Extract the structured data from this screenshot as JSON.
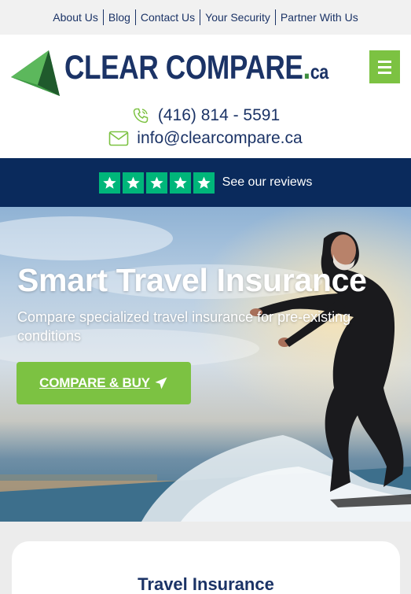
{
  "top_nav": {
    "items": [
      {
        "label": "About Us"
      },
      {
        "label": "Blog"
      },
      {
        "label": "Contact Us"
      },
      {
        "label": "Your Security"
      },
      {
        "label": "Partner With Us"
      }
    ]
  },
  "header": {
    "logo_text": "CLEAR COMPARE",
    "logo_dot": ".",
    "logo_suffix": "ca",
    "menu_icon": "hamburger-icon",
    "phone": "(416) 814 - 5591",
    "phone_icon": "phone-icon",
    "email": "info@clearcompare.ca",
    "email_icon": "envelope-icon"
  },
  "trust": {
    "rating_stars": 5,
    "reviews_link": "See our reviews",
    "star_color": "#00b67a",
    "band_color": "#0a2a5c"
  },
  "hero": {
    "title": "Smart Travel Insurance",
    "subtitle": "Compare specialized travel insurance for pre-existing conditions",
    "cta_label": "COMPARE & BUY",
    "cta_icon": "paper-plane-icon",
    "accent_color": "#7cc242"
  },
  "section": {
    "title": "Travel Insurance"
  },
  "colors": {
    "brand_navy": "#1b3366",
    "brand_green": "#7cc242"
  }
}
